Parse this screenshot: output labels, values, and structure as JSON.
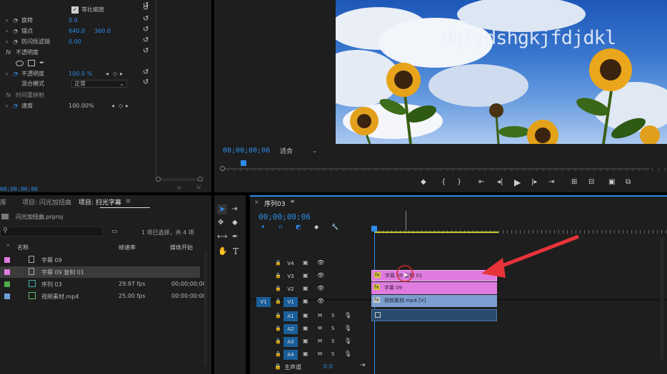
{
  "colors": {
    "accent_blue": "#2d8ceb",
    "clip_pink": "#e07ce0",
    "clip_blue": "#7b9fd0",
    "track_blue": "#1a5e9a",
    "yellow_bar": "#c8c830",
    "arrow_red": "#e8333a"
  },
  "effects": {
    "uniform_scale_label": "等比缩放",
    "rotation_label": "旋转",
    "rotation_value": "0.0",
    "anchor_label": "锚点",
    "anchor_x": "640.0",
    "anchor_y": "360.0",
    "flicker_label": "防闪烁滤镜",
    "flicker_value": "0.00",
    "opacity_section": "不透明度",
    "opacity_label": "不透明度",
    "opacity_value": "100.0 %",
    "blend_label": "混合模式",
    "blend_value": "正常",
    "remap_section": "时间重映射",
    "speed_label": "速度",
    "speed_value": "100.00%",
    "timecode": "00;00;06;06"
  },
  "program": {
    "overlay_text": "dgfjdshgkjfdjdkl",
    "timecode": "00;00;00;06",
    "zoom": "适合"
  },
  "project": {
    "tabs": [
      "库",
      "项目: 闪光加扭曲",
      "项目: 扫光字幕"
    ],
    "filename": "闪光加扭曲.prproj",
    "status": "1 项已选择，共 4 项",
    "col_name": "名称",
    "col_fps": "帧速率",
    "col_start": "媒体开始",
    "items": [
      {
        "name": "字幕 09",
        "fps": "",
        "start": "",
        "color": "#e07ce0"
      },
      {
        "name": "字幕 09 复制 01",
        "fps": "",
        "start": "",
        "color": "#e07ce0"
      },
      {
        "name": "序列 03",
        "fps": "29.97 fps",
        "start": "00;00;00;00",
        "color": "#4cae4c"
      },
      {
        "name": "视频素材.mp4",
        "fps": "25.00 fps",
        "start": "00:00:00:00",
        "color": "#6d9ed8"
      }
    ]
  },
  "timeline": {
    "title": "序列03",
    "timecode": "00;00;00;06",
    "tracks_video": [
      "V4",
      "V3",
      "V2",
      "V1"
    ],
    "tracks_audio": [
      "A1",
      "A2",
      "A3",
      "A4"
    ],
    "source_v": "V1",
    "master_label": "主声道",
    "master_value": "0.0",
    "clip_v3": "字幕 09 复制 01",
    "clip_v2": "字幕 09",
    "clip_v1": "视频素材.mp4 [V]"
  }
}
